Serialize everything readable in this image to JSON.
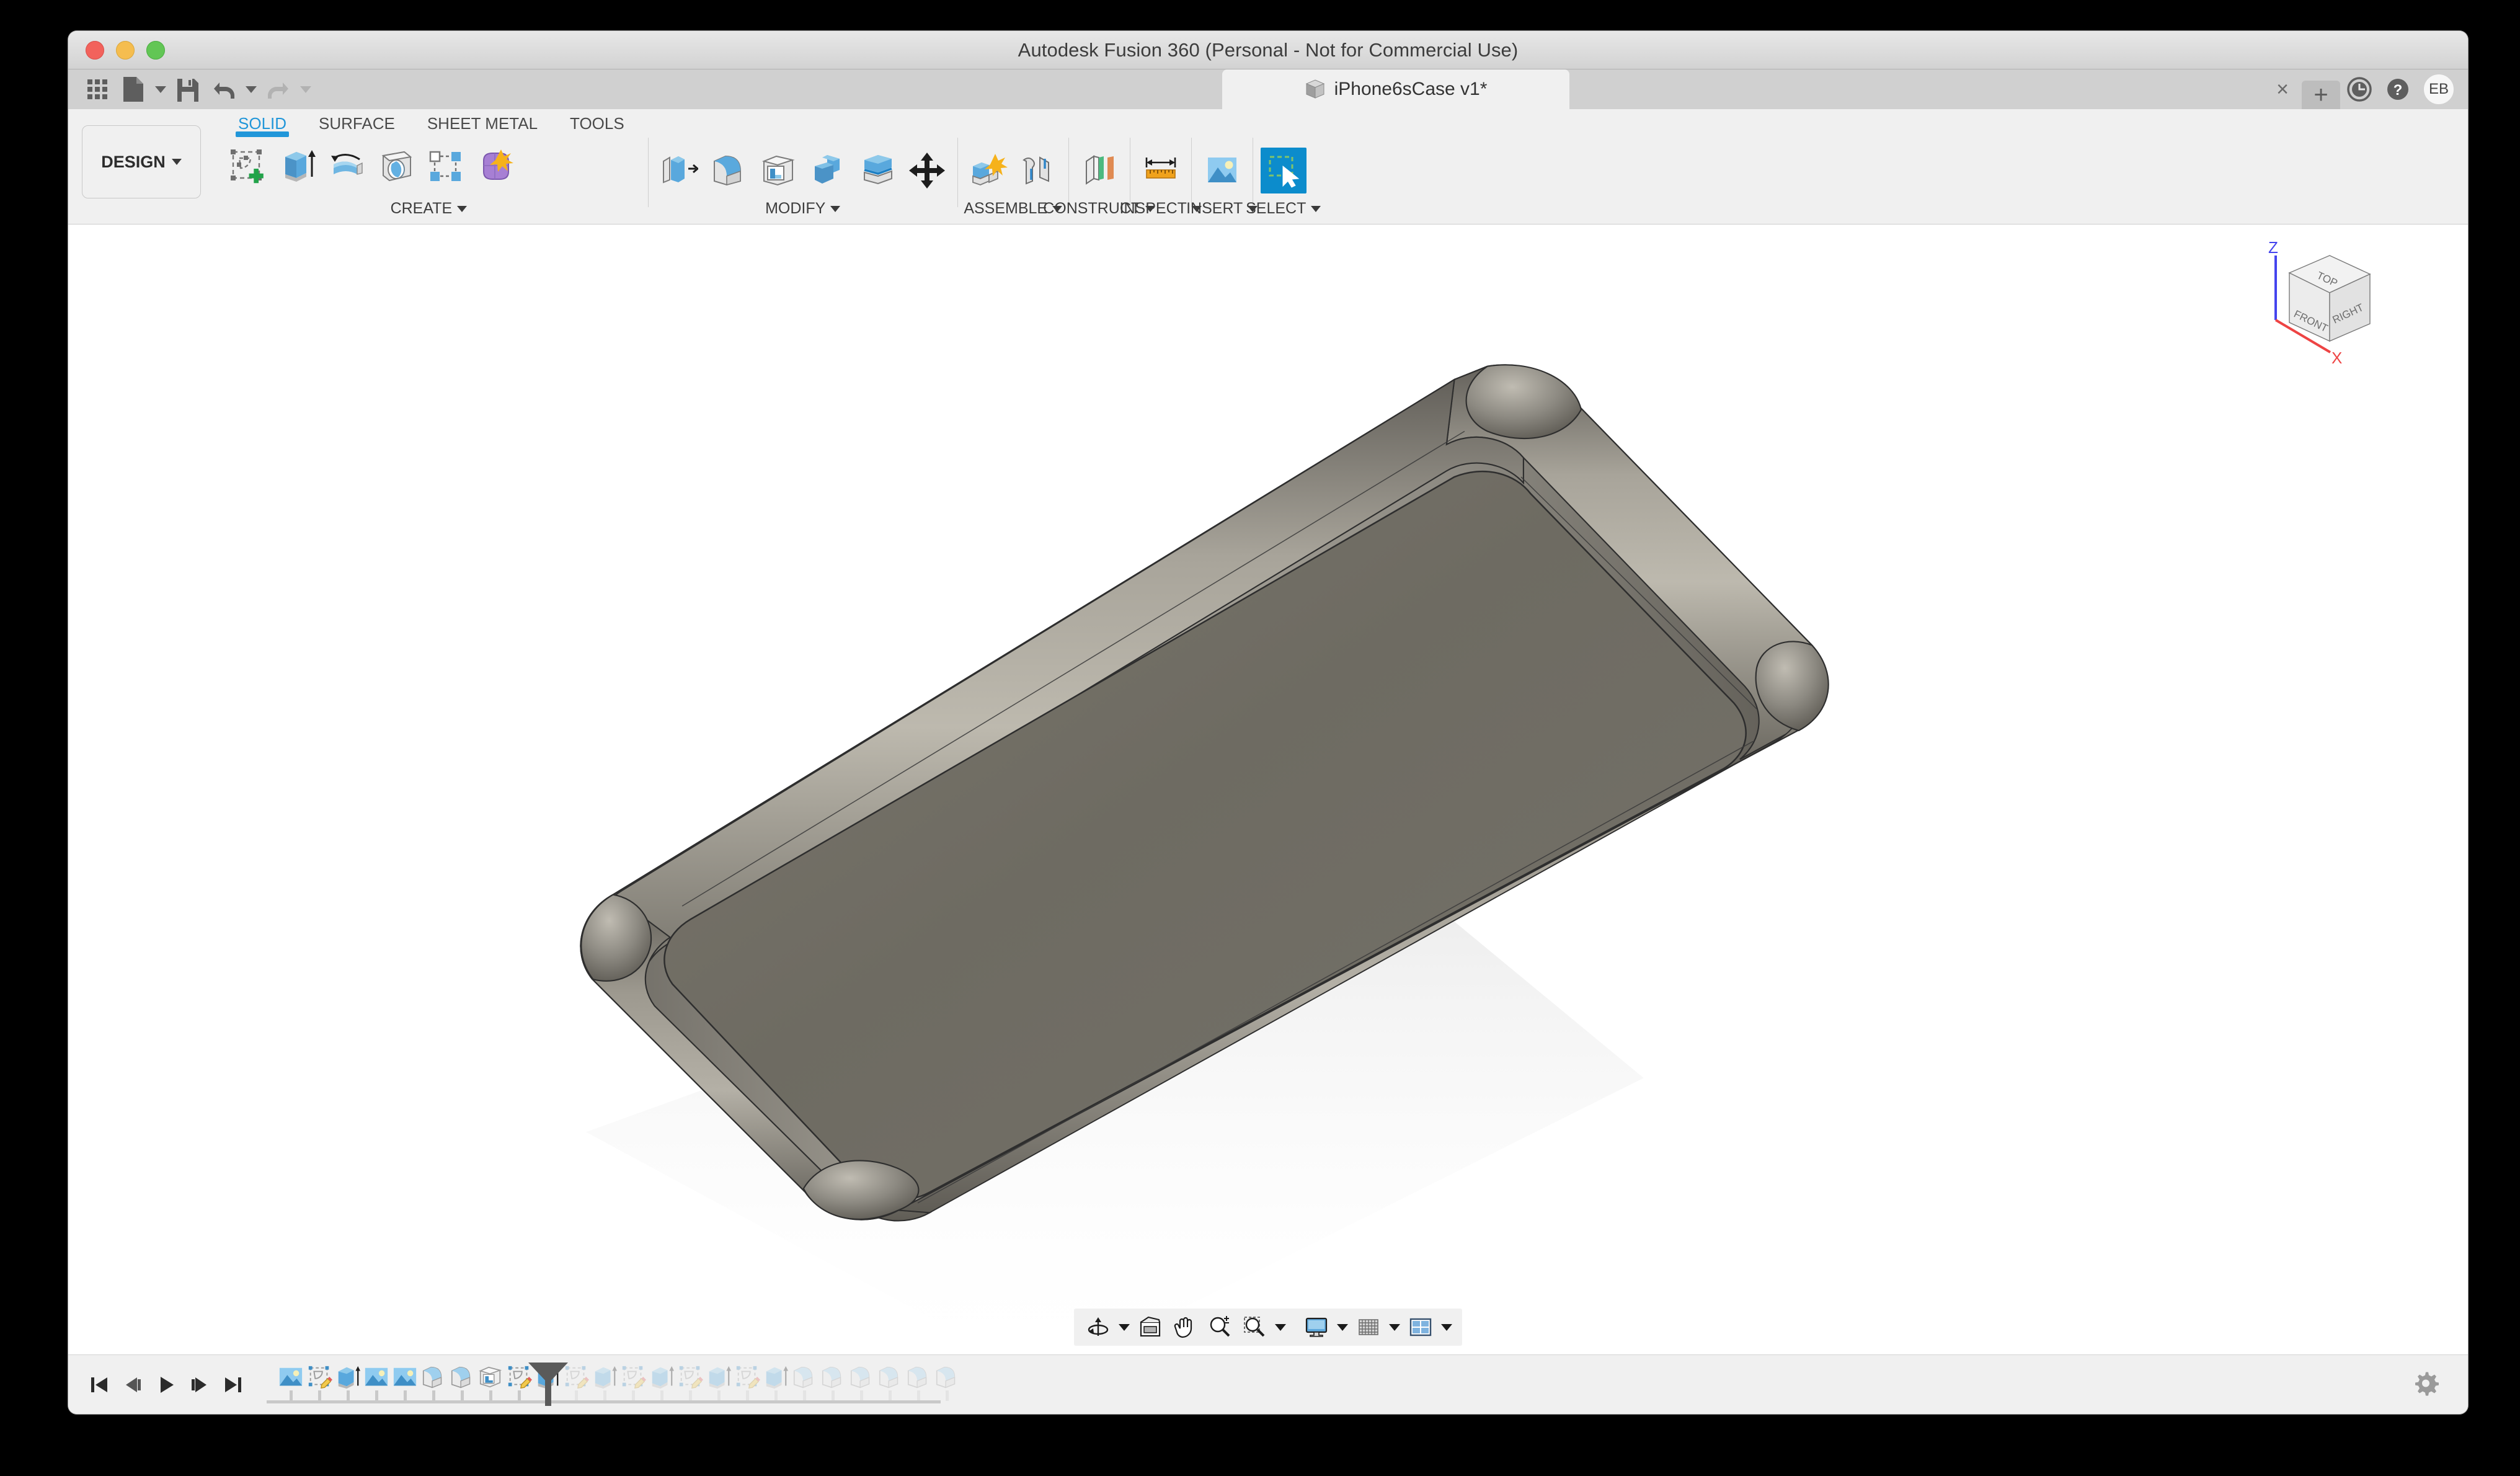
{
  "window": {
    "title": "Autodesk Fusion 360 (Personal - Not for Commercial Use)",
    "traffic_lights": [
      "close",
      "minimize",
      "zoom"
    ]
  },
  "quick_access": {
    "items": [
      {
        "name": "show-data-panel",
        "icon": "grid-icon",
        "disabled": false
      },
      {
        "name": "file-menu",
        "icon": "file-icon",
        "disabled": false
      },
      {
        "name": "file-menu-caret",
        "icon": "chevron-down-icon",
        "disabled": false
      },
      {
        "name": "save",
        "icon": "save-icon",
        "disabled": false
      },
      {
        "name": "undo",
        "icon": "undo-icon",
        "disabled": false
      },
      {
        "name": "undo-caret",
        "icon": "chevron-down-icon",
        "disabled": false
      },
      {
        "name": "redo",
        "icon": "redo-icon",
        "disabled": true
      },
      {
        "name": "redo-caret",
        "icon": "chevron-down-icon",
        "disabled": true
      }
    ]
  },
  "document_tab": {
    "label": "iPhone6sCase v1*",
    "icon": "cube-icon",
    "close_label": "×"
  },
  "tab_right": {
    "new_tab_label": "+",
    "job_status_icon": "clock-icon",
    "help_icon": "help-icon",
    "avatar_initials": "EB"
  },
  "ribbon": {
    "workspace_label": "DESIGN",
    "groups": [
      {
        "name": "create",
        "label": "CREATE",
        "tabs": [
          {
            "label": "SOLID",
            "active": true
          },
          {
            "label": "SURFACE",
            "active": false
          },
          {
            "label": "SHEET METAL",
            "active": false
          },
          {
            "label": "TOOLS",
            "active": false
          }
        ],
        "items": [
          {
            "name": "create-sketch",
            "icon": "sketch-plus-icon"
          },
          {
            "name": "extrude",
            "icon": "extrude-icon"
          },
          {
            "name": "revolve",
            "icon": "revolve-icon"
          },
          {
            "name": "sweep",
            "icon": "sweep-icon"
          },
          {
            "name": "rectangular-pattern",
            "icon": "pattern-icon"
          },
          {
            "name": "create-form",
            "icon": "form-icon"
          }
        ]
      },
      {
        "name": "modify",
        "label": "MODIFY",
        "items": [
          {
            "name": "press-pull",
            "icon": "press-pull-icon"
          },
          {
            "name": "fillet",
            "icon": "fillet-icon"
          },
          {
            "name": "shell",
            "icon": "shell-icon"
          },
          {
            "name": "combine",
            "icon": "combine-icon"
          },
          {
            "name": "split-face",
            "icon": "split-face-icon"
          },
          {
            "name": "move-copy",
            "icon": "move-icon"
          }
        ]
      },
      {
        "name": "assemble",
        "label": "ASSEMBLE",
        "items": [
          {
            "name": "new-component",
            "icon": "new-component-icon"
          },
          {
            "name": "joint",
            "icon": "joint-icon"
          }
        ]
      },
      {
        "name": "construct",
        "label": "CONSTRUCT",
        "items": [
          {
            "name": "offset-plane",
            "icon": "plane-icon"
          }
        ]
      },
      {
        "name": "inspect",
        "label": "INSPECT",
        "items": [
          {
            "name": "measure",
            "icon": "ruler-icon"
          }
        ]
      },
      {
        "name": "insert",
        "label": "INSERT",
        "items": [
          {
            "name": "insert-canvas",
            "icon": "image-icon"
          }
        ]
      },
      {
        "name": "select",
        "label": "SELECT",
        "items": [
          {
            "name": "select-tool",
            "icon": "select-cursor-icon",
            "selected": true
          }
        ]
      }
    ]
  },
  "viewcube": {
    "faces": {
      "top": "TOP",
      "front": "FRONT",
      "right": "RIGHT"
    },
    "axes": [
      {
        "label": "Z",
        "color": "#4444ee"
      },
      {
        "label": "X",
        "color": "#ee4444"
      }
    ]
  },
  "model": {
    "name": "iphone-case-body",
    "description": "Shelled rounded-rectangle phone case shown in isometric view",
    "colors": {
      "top_face": "#6f6c63",
      "rim_highlight": "#b9b5ab",
      "rim_shadow": "#57544d",
      "edge_line": "#2b2b2b",
      "shadow": "#e2e2e2"
    }
  },
  "navbar": {
    "items": [
      {
        "name": "orbit",
        "icon": "orbit-icon",
        "caret": true
      },
      {
        "name": "look-at",
        "icon": "look-at-icon",
        "caret": false
      },
      {
        "name": "pan",
        "icon": "pan-hand-icon",
        "caret": false
      },
      {
        "name": "zoom",
        "icon": "zoom-icon",
        "caret": false
      },
      {
        "name": "zoom-window",
        "icon": "zoom-window-icon",
        "caret": true
      },
      {
        "name": "display-settings",
        "icon": "monitor-icon",
        "caret": true
      },
      {
        "name": "grid-snaps",
        "icon": "grid-mesh-icon",
        "caret": true
      },
      {
        "name": "viewports",
        "icon": "viewports-icon",
        "caret": true
      }
    ]
  },
  "timeline": {
    "playback": [
      {
        "name": "go-to-beginning",
        "icon": "skip-start-icon"
      },
      {
        "name": "step-back",
        "icon": "step-back-icon"
      },
      {
        "name": "play",
        "icon": "play-icon"
      },
      {
        "name": "step-forward",
        "icon": "step-forward-icon"
      },
      {
        "name": "go-to-end",
        "icon": "skip-end-icon"
      }
    ],
    "marker_after_index": 9,
    "features": [
      {
        "name": "canvas",
        "icon": "canvas-icon"
      },
      {
        "name": "sketch",
        "icon": "sketch-edit-icon"
      },
      {
        "name": "extrude",
        "icon": "extrude-icon"
      },
      {
        "name": "canvas",
        "icon": "canvas-icon"
      },
      {
        "name": "canvas",
        "icon": "canvas-icon"
      },
      {
        "name": "fillet",
        "icon": "fillet-icon"
      },
      {
        "name": "fillet",
        "icon": "fillet-icon"
      },
      {
        "name": "shell",
        "icon": "shell-icon"
      },
      {
        "name": "sketch",
        "icon": "sketch-edit-icon"
      },
      {
        "name": "extrude",
        "icon": "extrude-icon"
      },
      {
        "name": "sketch",
        "icon": "sketch-edit-icon"
      },
      {
        "name": "extrude",
        "icon": "extrude-icon"
      },
      {
        "name": "sketch",
        "icon": "sketch-edit-icon"
      },
      {
        "name": "extrude",
        "icon": "extrude-icon"
      },
      {
        "name": "sketch",
        "icon": "sketch-edit-icon"
      },
      {
        "name": "extrude",
        "icon": "extrude-icon"
      },
      {
        "name": "sketch",
        "icon": "sketch-edit-icon"
      },
      {
        "name": "extrude",
        "icon": "extrude-icon"
      },
      {
        "name": "fillet",
        "icon": "fillet-icon"
      },
      {
        "name": "fillet",
        "icon": "fillet-icon"
      },
      {
        "name": "fillet",
        "icon": "fillet-icon"
      },
      {
        "name": "fillet",
        "icon": "fillet-icon"
      },
      {
        "name": "fillet",
        "icon": "fillet-icon"
      },
      {
        "name": "fillet",
        "icon": "fillet-icon"
      }
    ],
    "settings_icon": "gear-icon"
  }
}
